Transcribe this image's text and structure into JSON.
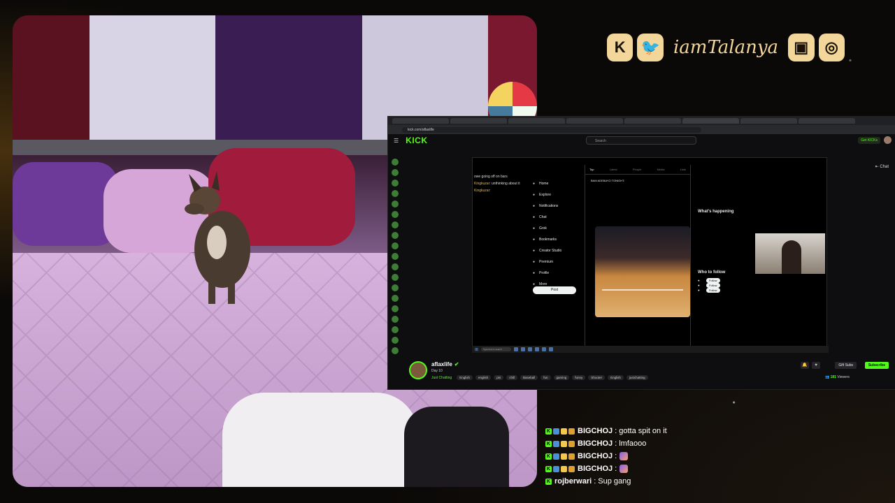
{
  "social": {
    "handle": "iamTalanya",
    "icons": [
      "kick-icon",
      "twitter-icon",
      "twitch-icon",
      "instagram-icon"
    ],
    "icon_glyphs": [
      "K",
      "🐦",
      "▣",
      "◎"
    ]
  },
  "browser": {
    "tabs": [
      "",
      "",
      "",
      "",
      "",
      "",
      "",
      "",
      "",
      "",
      ""
    ],
    "url": "kick.com/aflaxlife"
  },
  "kick": {
    "logo": "KICK",
    "search_placeholder": "Search",
    "get_kick": "Get KICKs",
    "chat_tab": "Chat"
  },
  "inner_chat": [
    {
      "user": "",
      "text": "owe going off on bars"
    },
    {
      "user": "Kingkuzar:",
      "text": "unthinking about it"
    },
    {
      "user": "Kingkuzar:",
      "text": ""
    }
  ],
  "x_nav": [
    "Home",
    "Explore",
    "Notifications",
    "Chat",
    "Grok",
    "Bookmarks",
    "Creator Studio",
    "Premium",
    "Profile",
    "More"
  ],
  "x_post": "Post",
  "x_feed": {
    "tabs": [
      "Top",
      "Latest",
      "People",
      "Media",
      "Lists"
    ],
    "post_text": "BAM ADEBAYO TONIGHT:"
  },
  "x_side": {
    "happening_title": "What's happening",
    "follow_title": "Who to follow",
    "follow_label": "Follow"
  },
  "taskbar": {
    "search": "Type here to search"
  },
  "stream": {
    "name": "aflaxlife",
    "title": "Day 10",
    "category": "Just Chatting",
    "tags": [
      "English",
      "english",
      "pts",
      "chill",
      "Baseball",
      "fun",
      "gaming",
      "funny",
      "Shooter",
      "English",
      "justchatting"
    ],
    "gift": "Gift Subs",
    "subscribe": "Subscribe",
    "viewers_count": "181",
    "viewers_label": "Viewers"
  },
  "overlay_chat": [
    {
      "user": "BIGCHOJ",
      "text": ": gotta spit on it",
      "emote": false
    },
    {
      "user": "BIGCHOJ",
      "text": ": lmfaooo",
      "emote": false
    },
    {
      "user": "BIGCHOJ",
      "text": ":",
      "emote": true
    },
    {
      "user": "BIGCHOJ",
      "text": ":",
      "emote": true
    },
    {
      "user": "rojberwari",
      "text": ": Sup gang",
      "emote": false
    }
  ],
  "colors": {
    "kick_green": "#53fc18",
    "gold": "#f3d79a"
  }
}
